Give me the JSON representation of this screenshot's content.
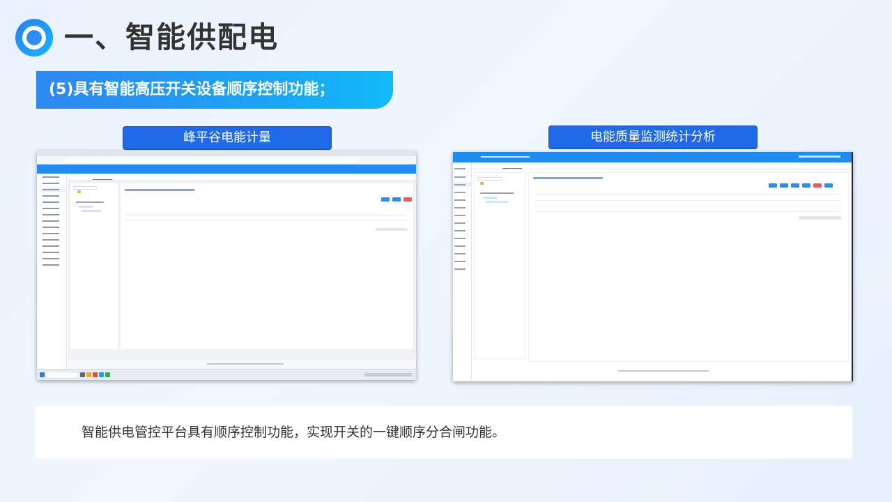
{
  "title": "一、智能供配电",
  "subtitle": "(5)具有智能高压开关设备顺序控制功能；",
  "panels": {
    "left_label": "峰平谷电能计量",
    "right_label": "电能质量监测统计分析"
  },
  "description": "智能供电管控平台具有顺序控制功能，实现开关的一键顺序分合闸功能。",
  "colors": {
    "accent_blue": "#2069e8",
    "subtitle_gradient_start": "#2f88f2",
    "subtitle_gradient_end": "#12bbf8",
    "app_header_blue": "#1e8cf0"
  },
  "icons": {
    "header_logo": "ring-logo-icon"
  }
}
